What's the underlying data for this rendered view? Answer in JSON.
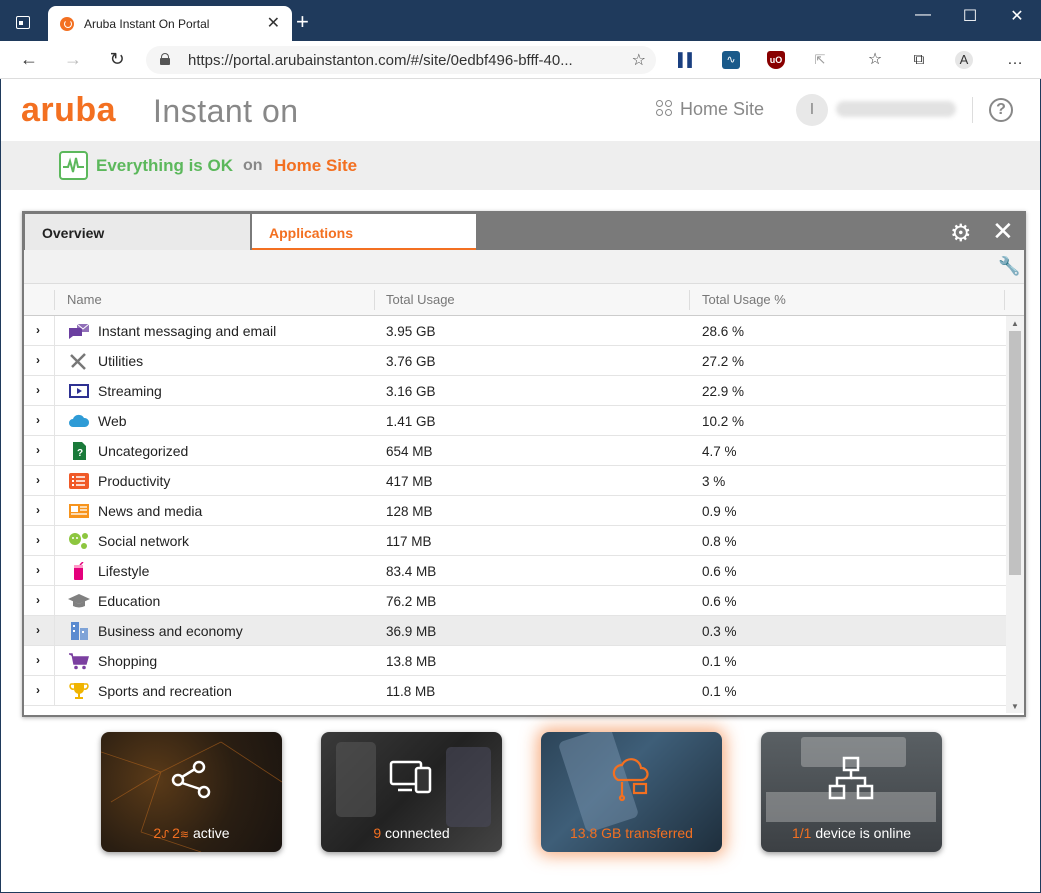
{
  "browser": {
    "tab_title": "Aruba Instant On Portal",
    "url": "https://portal.arubainstanton.com/#/site/0edbf496-bfff-40...",
    "extensions": [
      "bars-icon",
      "pulse-icon",
      "ublock-icon",
      "cursor-icon"
    ]
  },
  "header": {
    "logo": "aruba",
    "product": "Instant on",
    "site_name": "Home Site",
    "user_initial": "I"
  },
  "status": {
    "message": "Everything is OK",
    "on": "on",
    "site": "Home Site"
  },
  "panel": {
    "tabs": [
      {
        "label": "Overview",
        "selected": false
      },
      {
        "label": "Applications",
        "selected": true
      }
    ],
    "columns": [
      "Name",
      "Total Usage",
      "Total Usage %"
    ],
    "rows": [
      {
        "icon": "chat-mail-icon",
        "color": "#6b3fa0",
        "name": "Instant messaging and email",
        "usage": "3.95 GB",
        "pct": "28.6 %"
      },
      {
        "icon": "tools-icon",
        "color": "#777777",
        "name": "Utilities",
        "usage": "3.76 GB",
        "pct": "27.2 %"
      },
      {
        "icon": "video-play-icon",
        "color": "#2e3192",
        "name": "Streaming",
        "usage": "3.16 GB",
        "pct": "22.9 %"
      },
      {
        "icon": "cloud-icon",
        "color": "#2e9bd6",
        "name": "Web",
        "usage": "1.41 GB",
        "pct": "10.2 %"
      },
      {
        "icon": "question-doc-icon",
        "color": "#1a7a3a",
        "name": "Uncategorized",
        "usage": "654 MB",
        "pct": "4.7 %"
      },
      {
        "icon": "checklist-icon",
        "color": "#f05a28",
        "name": "Productivity",
        "usage": "417 MB",
        "pct": "3 %"
      },
      {
        "icon": "newspaper-icon",
        "color": "#f7941d",
        "name": "News and media",
        "usage": "128 MB",
        "pct": "0.9 %"
      },
      {
        "icon": "social-nodes-icon",
        "color": "#8dc63f",
        "name": "Social network",
        "usage": "117 MB",
        "pct": "0.8 %"
      },
      {
        "icon": "drink-icon",
        "color": "#e4007c",
        "name": "Lifestyle",
        "usage": "83.4 MB",
        "pct": "0.6 %"
      },
      {
        "icon": "graduation-cap-icon",
        "color": "#808080",
        "name": "Education",
        "usage": "76.2 MB",
        "pct": "0.6 %"
      },
      {
        "icon": "buildings-icon",
        "color": "#5b8bd0",
        "name": "Business and economy",
        "usage": "36.9 MB",
        "pct": "0.3 %"
      },
      {
        "icon": "cart-icon",
        "color": "#7b3fa0",
        "name": "Shopping",
        "usage": "13.8 MB",
        "pct": "0.1 %"
      },
      {
        "icon": "trophy-icon",
        "color": "#f0b400",
        "name": "Sports and recreation",
        "usage": "11.8 MB",
        "pct": "0.1 %"
      }
    ],
    "hovered_row": 10
  },
  "cards": [
    {
      "id": "networks",
      "icon": "share-nodes-icon",
      "num1": "2",
      "num2": "2",
      "label": "active"
    },
    {
      "id": "clients",
      "icon": "devices-icon",
      "num": "9",
      "label": "connected"
    },
    {
      "id": "traffic",
      "icon": "cloud-transfer-icon",
      "num": "13.8 GB transferred",
      "label": ""
    },
    {
      "id": "devices",
      "icon": "topology-icon",
      "num": "1/1",
      "label": "device is online"
    }
  ],
  "colors": {
    "accent": "#f37021",
    "ok": "#5cb85c",
    "titlebar": "#1f3a5c"
  }
}
